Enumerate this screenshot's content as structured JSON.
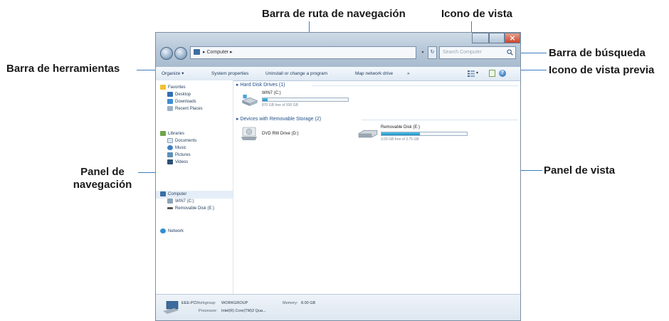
{
  "callouts": {
    "navigation_path_bar": "Barra de ruta de navegación",
    "view_icon": "Icono de vista",
    "search_bar": "Barra de búsqueda",
    "toolbar": "Barra de herramientas",
    "preview_icon": "Icono de vista previa",
    "navigation_pane": "Panel de navegación",
    "view_pane": "Panel de vista"
  },
  "window": {
    "address": "▸ Computer ▸",
    "search_placeholder": "Search Computer",
    "refresh_glyph": "↻",
    "dropdown_glyph": "▾"
  },
  "toolbar": {
    "items": [
      "Organize ▾",
      "System properties",
      "Uninstall or change a program",
      "Map network drive",
      "»"
    ],
    "view_arrow": "▾",
    "help_glyph": "?"
  },
  "nav": {
    "favorites": "Favorites",
    "desktop": "Desktop",
    "downloads": "Downloads",
    "recent_places": "Recent Places",
    "libraries": "Libraries",
    "documents": "Documents",
    "music": "Music",
    "pictures": "Pictures",
    "videos": "Videos",
    "computer": "Computer",
    "drive_c": "WIN7 (C:)",
    "drive_e": "Removable Disk (E:)",
    "network": "Network"
  },
  "content": {
    "group_hdd": "▸ Hard Disk Drives (1)",
    "group_removable": "▸ Devices with Removable Storage (2)",
    "drives": [
      {
        "label": "WIN7 (C:)",
        "free": "870 GB free of 930 GB",
        "used_fraction": 0.06
      },
      {
        "label": "DVD RW Drive (D:)"
      },
      {
        "label": "Removable Disk (E:)",
        "free": "3.09 GB free of 3.75 GB",
        "used_fraction": 0.45
      }
    ]
  },
  "details": {
    "computer_name": "EEE-PC",
    "workgroup_label": "Workgroup:",
    "workgroup_value": "WORKGROUP",
    "memory_label": "Memory:",
    "memory_value": "8.00 GB",
    "processor_label": "Processor:",
    "processor_value": "Intel(R) Core(TM)2 Qua..."
  },
  "colors": {
    "callout_line": "#3a7fc1",
    "progress_fill": "#1d8fc4",
    "close_button": "#c8442c"
  }
}
